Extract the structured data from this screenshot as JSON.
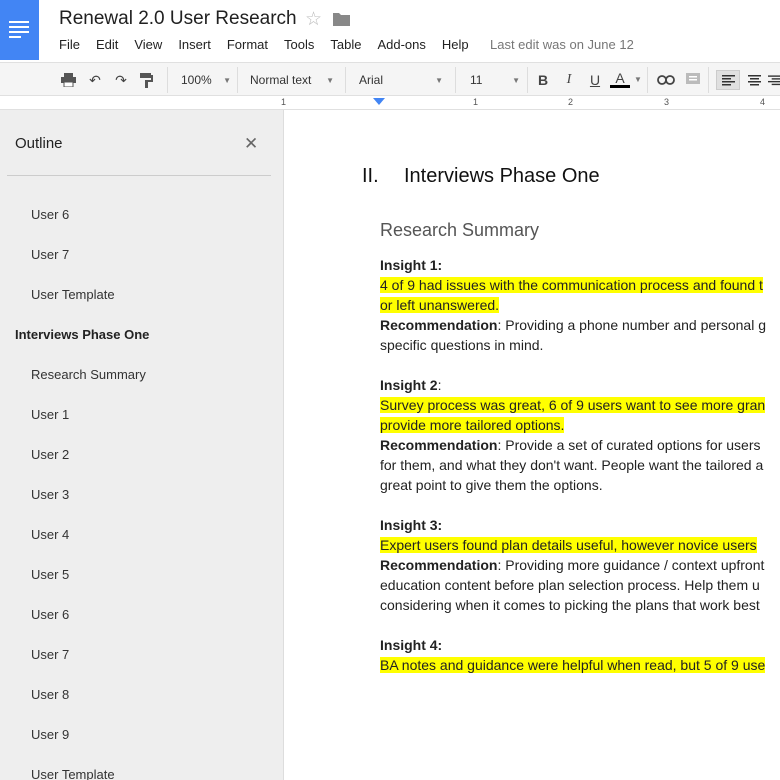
{
  "doc": {
    "title": "Renewal 2.0 User Research",
    "menu": [
      "File",
      "Edit",
      "View",
      "Insert",
      "Format",
      "Tools",
      "Table",
      "Add-ons",
      "Help"
    ],
    "last_edit": "Last edit was on June 12"
  },
  "toolbar": {
    "zoom": "100%",
    "style": "Normal text",
    "font": "Arial",
    "size": "11",
    "bold": "B",
    "italic": "I",
    "underline": "U",
    "text_color": "A"
  },
  "ruler": {
    "marks": [
      "1",
      "1",
      "2",
      "3",
      "4"
    ]
  },
  "outline": {
    "title": "Outline",
    "items": [
      {
        "label": "User 6",
        "level": 2
      },
      {
        "label": "User 7",
        "level": 2
      },
      {
        "label": "User Template",
        "level": 2
      },
      {
        "label": "Interviews Phase One",
        "level": 1
      },
      {
        "label": "Research Summary",
        "level": 2
      },
      {
        "label": "User 1",
        "level": 2
      },
      {
        "label": "User 2",
        "level": 2
      },
      {
        "label": "User 3",
        "level": 2
      },
      {
        "label": "User 4",
        "level": 2
      },
      {
        "label": "User 5",
        "level": 2
      },
      {
        "label": "User 6",
        "level": 2
      },
      {
        "label": "User 7",
        "level": 2
      },
      {
        "label": "User 8",
        "level": 2
      },
      {
        "label": "User 9",
        "level": 2
      },
      {
        "label": "User Template",
        "level": 2
      }
    ]
  },
  "content": {
    "h1_num": "II.",
    "h1_text": "Interviews Phase One",
    "h2": "Research Summary",
    "insight1_label": "Insight 1:",
    "insight1_l1": "4 of 9 had issues with the communication process and found t",
    "insight1_l2": "or left unanswered.",
    "rec_label": "Recommendation",
    "rec1_l1": ": Providing a phone number and personal g",
    "rec1_l2": "specific questions in mind.",
    "insight2_label": "Insight 2",
    "insight2_colon": ":",
    "insight2_l1": "Survey process was great, 6 of 9 users want to see more gran",
    "insight2_l2": "provide more tailored options.",
    "rec2_l1": ": Provide a set of curated options for users",
    "rec2_l2": "for them, and what they don't want. People want the tailored a",
    "rec2_l3": "great point to give them the options.",
    "insight3_label": "Insight 3:",
    "insight3_l1": "Expert users found plan details useful, however novice users",
    "rec3_l1": ": Providing more guidance / context upfront",
    "rec3_l2": "education content before plan selection process. Help them u",
    "rec3_l3": "considering when it comes to picking the plans that work best",
    "insight4_label": "Insight 4:",
    "insight4_l1": "BA notes and guidance were helpful when read, but 5 of 9 use"
  },
  "colors": {
    "highlight": "#ffff00",
    "docs_blue": "#4285f4"
  }
}
